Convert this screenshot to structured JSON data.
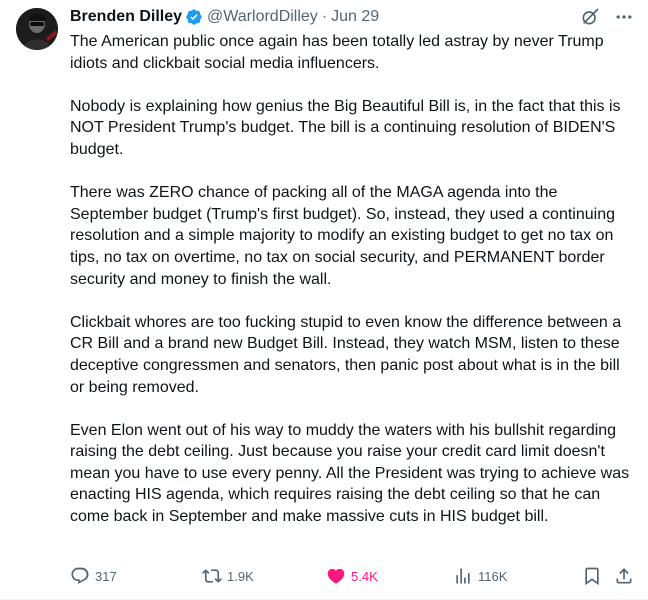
{
  "author": {
    "display_name": "Brenden Dilley",
    "handle": "@WarlordDilley",
    "separator": "·",
    "date": "Jun 29",
    "verified": true,
    "avatar_icon": "avatar-photo"
  },
  "header_icons": [
    "grok-icon",
    "more-icon"
  ],
  "paragraphs": [
    "The American public once again has been totally led astray by never Trump idiots and clickbait social media influencers.",
    "Nobody is explaining how genius the Big Beautiful Bill is, in the fact that this is NOT President Trump's budget. The bill is a continuing resolution of BIDEN'S budget.",
    "There was ZERO chance of packing all of the MAGA agenda into the September budget (Trump's first budget). So, instead, they used a continuing resolution and a simple majority to modify an existing budget to get no tax on tips, no tax on overtime, no tax on social security, and PERMANENT border security and money to finish the wall.",
    "Clickbait whores are too fucking stupid to even know the difference between a CR Bill and a brand new Budget Bill. Instead, they watch MSM, listen to these deceptive congressmen and senators, then panic post about what is in the bill or being removed.",
    "Even Elon went out of his way to muddy the waters with his bullshit regarding raising the debt ceiling. Just because you raise your credit card limit doesn't mean you have to use every penny. All the President was trying to achieve was enacting HIS agenda, which requires raising the debt ceiling so that he can come back in September and make massive cuts in HIS budget bill."
  ],
  "actions": {
    "replies": "317",
    "reposts": "1.9K",
    "likes": "5.4K",
    "views": "116K",
    "like_color": "#f91880",
    "muted_color": "#536471",
    "verified_color": "#1d9bf0"
  }
}
